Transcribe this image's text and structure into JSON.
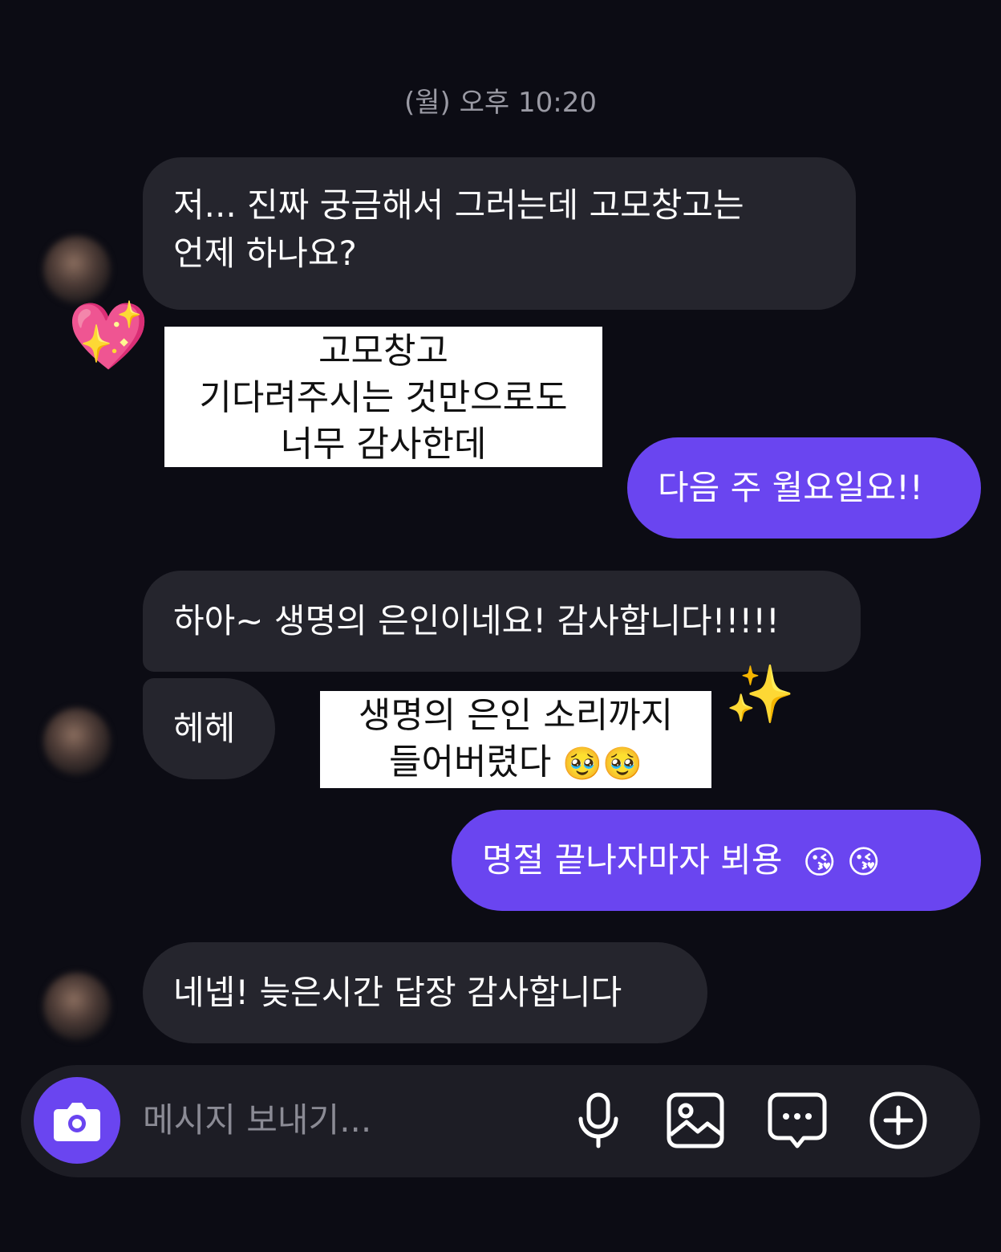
{
  "timestamp": "(월) 오후 10:20",
  "messages": {
    "m1_line1": "저... 진짜 궁금해서 그러는데 고모창고는",
    "m1_line2": "언제 하나요?",
    "m2": "다음 주 월요일요!!",
    "m3": "하아~ 생명의 은인이네요! 감사합니다!!!!!",
    "m4": "헤헤",
    "m5": "명절 끝나자마자 뵈용",
    "m6": "네넵! 늦은시간 답장 감사합니다"
  },
  "overlays": {
    "note1": [
      "고모창고",
      "기다려주시는 것만으로도",
      "너무 감사한데"
    ],
    "note2_line1": "생명의 은인 소리까지",
    "note2_line2": "들어버렸다"
  },
  "emojis": {
    "heart": "💖",
    "pleading": "🥹",
    "kiss": "😘",
    "sparkles": "✨"
  },
  "composer": {
    "placeholder": "메시지 보내기..."
  },
  "icons": [
    "camera-icon",
    "microphone-icon",
    "image-icon",
    "chat-dots-icon",
    "plus-circle-icon"
  ],
  "colors": {
    "background": "#0c0c14",
    "incoming_bubble": "#25252d",
    "outgoing_bubble": "#6a45f0"
  }
}
